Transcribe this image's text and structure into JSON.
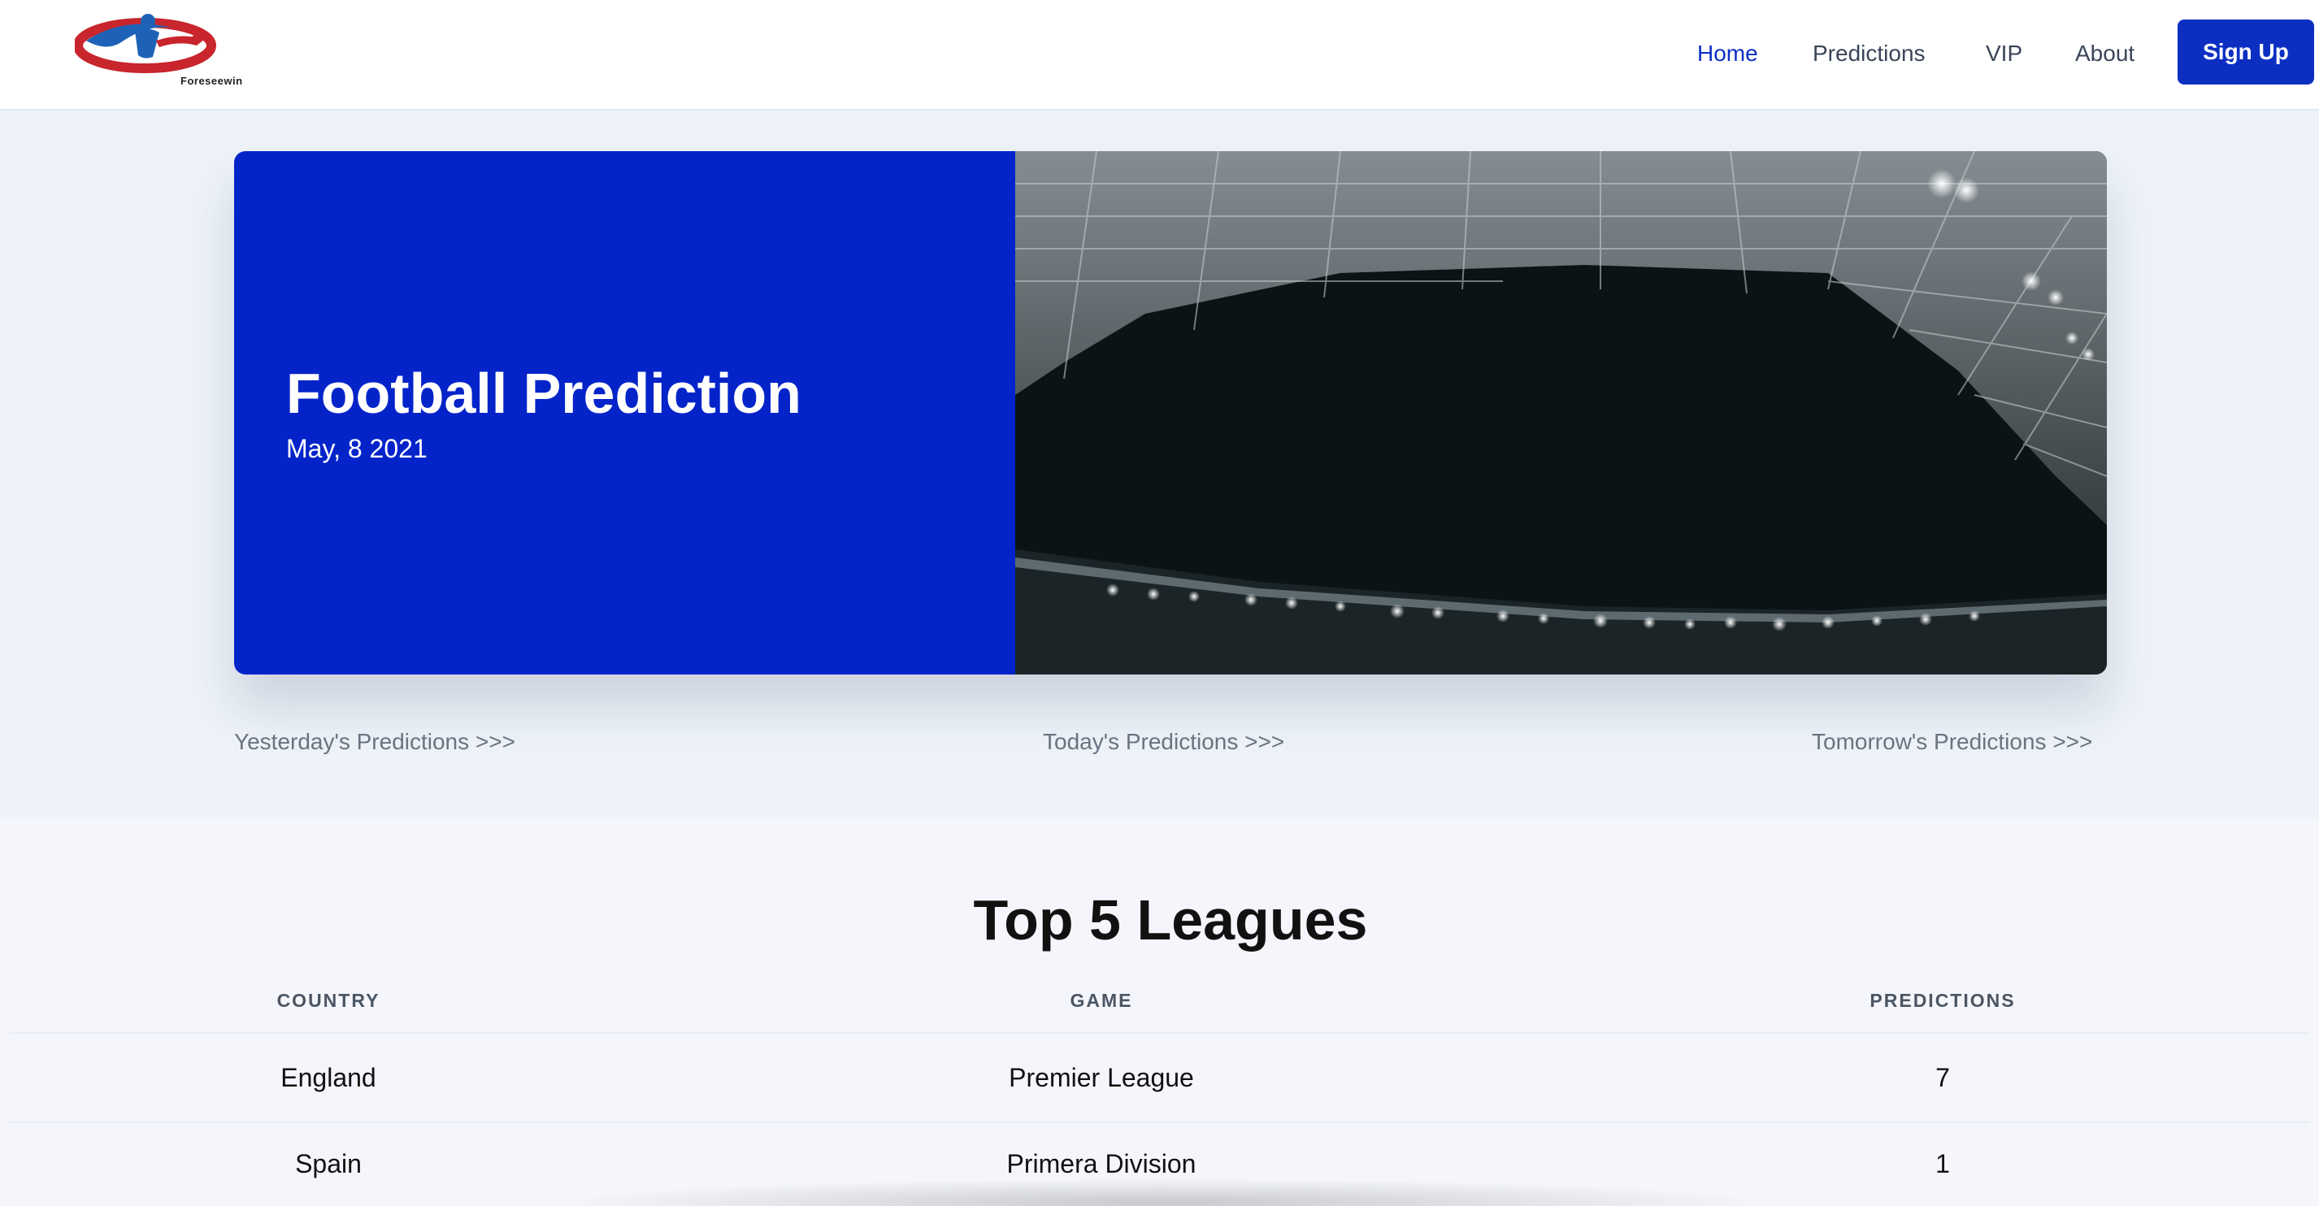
{
  "header": {
    "logo_text": "Foreseewin",
    "nav": [
      {
        "label": "Home",
        "active": true
      },
      {
        "label": "Predictions",
        "active": false
      },
      {
        "label": "VIP",
        "active": false
      },
      {
        "label": "About",
        "active": false
      }
    ],
    "signup_label": "Sign Up"
  },
  "hero": {
    "title": "Football Prediction",
    "date": "May, 8 2021"
  },
  "links": {
    "yesterday": "Yesterday's Predictions >>>",
    "today": "Today's Predictions >>>",
    "tomorrow": "Tomorrow's Predictions >>>"
  },
  "leagues": {
    "title": "Top 5 Leagues",
    "columns": [
      "COUNTRY",
      "GAME",
      "PREDICTIONS"
    ],
    "rows": [
      {
        "country": "England",
        "game": "Premier League",
        "predictions": "7"
      },
      {
        "country": "Spain",
        "game": "Primera Division",
        "predictions": "1"
      }
    ]
  },
  "colors": {
    "brand_blue": "#0424c9",
    "active_nav": "#0b2fc7",
    "page_bg": "#eef3f9"
  }
}
